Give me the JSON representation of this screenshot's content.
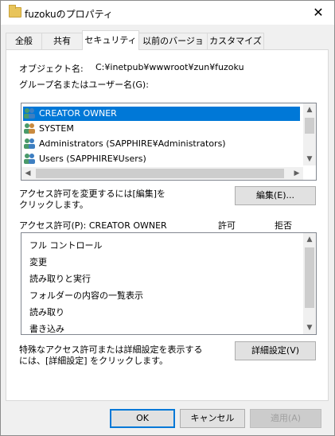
{
  "window": {
    "title": "fuzokuのプロパティ"
  },
  "tabs": [
    {
      "label": "全般"
    },
    {
      "label": "共有"
    },
    {
      "label": "セキュリティ"
    },
    {
      "label": "以前のバージョン"
    },
    {
      "label": "カスタマイズ"
    }
  ],
  "security": {
    "object_label": "オブジェクト名:",
    "object_value": "C:¥inetpub¥wwwroot¥zun¥fuzoku",
    "groups_label": "グループ名またはユーザー名(G):",
    "groups": [
      {
        "name": "CREATOR OWNER",
        "selected": true
      },
      {
        "name": "SYSTEM",
        "selected": false
      },
      {
        "name": "Administrators (SAPPHIRE¥Administrators)",
        "selected": false
      },
      {
        "name": "Users (SAPPHIRE¥Users)",
        "selected": false
      }
    ],
    "change_note_line1": "アクセス許可を変更するには[編集]を",
    "change_note_line2": "クリックします。",
    "edit_button": "編集(E)...",
    "perm_label": "アクセス許可(P): CREATOR OWNER",
    "allow_header": "許可",
    "deny_header": "拒否",
    "permissions": [
      {
        "name": "フル コントロール"
      },
      {
        "name": "変更"
      },
      {
        "name": "読み取りと実行"
      },
      {
        "name": "フォルダーの内容の一覧表示"
      },
      {
        "name": "読み取り"
      },
      {
        "name": "書き込み"
      }
    ],
    "advanced_note_line1": "特殊なアクセス許可または詳細設定を表示する",
    "advanced_note_line2": "には、[詳細設定] をクリックします。",
    "advanced_button": "詳細設定(V)"
  },
  "footer": {
    "ok": "OK",
    "cancel": "キャンセル",
    "apply": "適用(A)"
  },
  "colors": {
    "selection": "#0078d7",
    "default_button_border": "#0078d7"
  }
}
